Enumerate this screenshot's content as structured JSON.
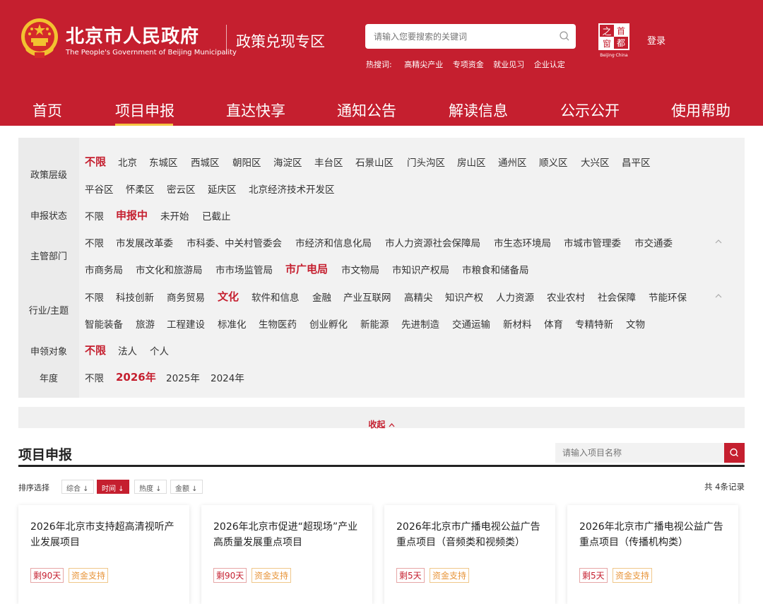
{
  "header": {
    "site_name_cn": "北京市人民政府",
    "site_name_en": "The People's Government of Beijing Municipality",
    "zone_title": "政策兑现专区",
    "search_placeholder": "请输入您要搜索的关键词",
    "hot_label": "热搜词:",
    "hot_words": [
      "高精尖产业",
      "专项资金",
      "就业见习",
      "企业认定"
    ],
    "capital_logo_sub": "Beijing·China",
    "login": "登录"
  },
  "nav": {
    "items": [
      "首页",
      "项目申报",
      "直达快享",
      "通知公告",
      "解读信息",
      "公示公开",
      "使用帮助"
    ],
    "active": "项目申报"
  },
  "filters": {
    "level": {
      "label": "政策层级",
      "options": [
        "不限",
        "北京",
        "东城区",
        "西城区",
        "朝阳区",
        "海淀区",
        "丰台区",
        "石景山区",
        "门头沟区",
        "房山区",
        "通州区",
        "顺义区",
        "大兴区",
        "昌平区",
        "平谷区",
        "怀柔区",
        "密云区",
        "延庆区",
        "北京经济技术开发区"
      ],
      "selected": "不限"
    },
    "status": {
      "label": "申报状态",
      "options": [
        "不限",
        "申报中",
        "未开始",
        "已截止"
      ],
      "selected": "申报中"
    },
    "dept": {
      "label": "主管部门",
      "options": [
        "不限",
        "市发展改革委",
        "市科委、中关村管委会",
        "市经济和信息化局",
        "市人力资源社会保障局",
        "市生态环境局",
        "市城市管理委",
        "市交通委",
        "市商务局",
        "市文化和旅游局",
        "市市场监管局",
        "市广电局",
        "市文物局",
        "市知识产权局",
        "市粮食和储备局"
      ],
      "selected": "市广电局"
    },
    "industry": {
      "label": "行业/主题",
      "options": [
        "不限",
        "科技创新",
        "商务贸易",
        "文化",
        "软件和信息",
        "金融",
        "产业互联网",
        "高精尖",
        "知识产权",
        "人力资源",
        "农业农村",
        "社会保障",
        "节能环保",
        "智能装备",
        "旅游",
        "工程建设",
        "标准化",
        "生物医药",
        "创业孵化",
        "新能源",
        "先进制造",
        "交通运输",
        "新材料",
        "体育",
        "专精特新",
        "文物"
      ],
      "selected": "文化"
    },
    "target": {
      "label": "申领对象",
      "options": [
        "不限",
        "法人",
        "个人"
      ],
      "selected": "不限"
    },
    "year": {
      "label": "年度",
      "options": [
        "不限",
        "2026年",
        "2025年",
        "2024年"
      ],
      "selected": "2026年"
    }
  },
  "collapse_label": "收起",
  "projects": {
    "title": "项目申报",
    "search_placeholder": "请输入项目名称",
    "sort_label": "排序选择",
    "sort_options": [
      "综合",
      "时间",
      "热度",
      "金额"
    ],
    "sort_active": "时间",
    "total": "共 4条记录",
    "cards": [
      {
        "title": "2026年北京市支持超高清视听产业发展项目",
        "days": "剩90天",
        "tag": "资金支持"
      },
      {
        "title": "2026年北京市促进“超现场”产业高质量发展重点项目",
        "days": "剩90天",
        "tag": "资金支持"
      },
      {
        "title": "2026年北京市广播电视公益广告重点项目（音频类和视频类）",
        "days": "剩5天",
        "tag": "资金支持"
      },
      {
        "title": "2026年北京市广播电视公益广告重点项目（传播机构类）",
        "days": "剩5天",
        "tag": "资金支持"
      }
    ]
  },
  "colors": {
    "brand_red": "#c51f2f",
    "nav_underline": "#f5c542",
    "fund_tag": "#e8953a"
  }
}
